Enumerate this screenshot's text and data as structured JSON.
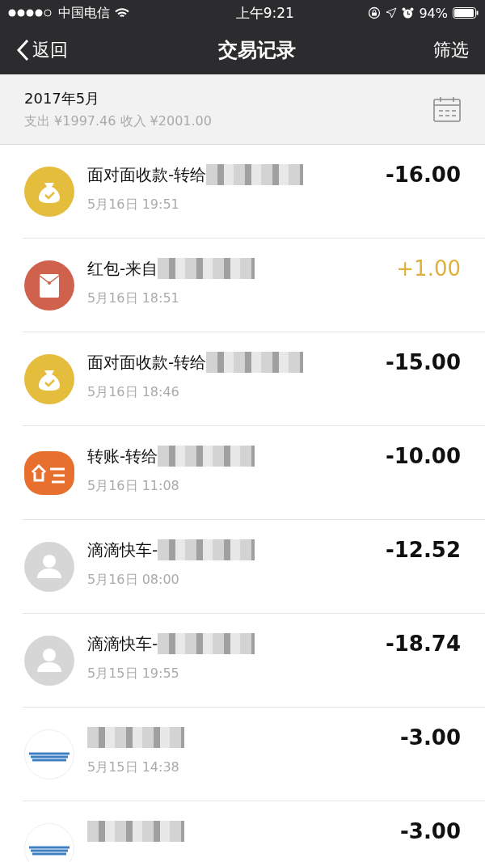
{
  "status_bar": {
    "carrier": "中国电信",
    "time": "上午9:21",
    "battery": "94%"
  },
  "nav": {
    "back": "返回",
    "title": "交易记录",
    "action": "筛选"
  },
  "summary": {
    "month": "2017年5月",
    "totals": "支出 ¥1997.46 收入 ¥2001.00"
  },
  "transactions": [
    {
      "kind": "money-bag",
      "title": "面对面收款-转给",
      "time": "5月16日 19:51",
      "amount": "-16.00",
      "income": false
    },
    {
      "kind": "red-packet",
      "title": "红包-来自",
      "time": "5月16日 18:51",
      "amount": "+1.00",
      "income": true
    },
    {
      "kind": "money-bag",
      "title": "面对面收款-转给",
      "time": "5月16日 18:46",
      "amount": "-15.00",
      "income": false
    },
    {
      "kind": "merchant",
      "title": "转账-转给",
      "time": "5月16日 11:08",
      "amount": "-10.00",
      "income": false
    },
    {
      "kind": "avatar",
      "title": "滴滴快车-",
      "time": "5月16日 08:00",
      "amount": "-12.52",
      "income": false
    },
    {
      "kind": "avatar",
      "title": "滴滴快车-",
      "time": "5月15日 19:55",
      "amount": "-18.74",
      "income": false
    },
    {
      "kind": "logo",
      "time": "5月15日 14:38",
      "amount": "-3.00",
      "income": false
    },
    {
      "kind": "logo",
      "amount": "-3.00",
      "income": false
    }
  ]
}
